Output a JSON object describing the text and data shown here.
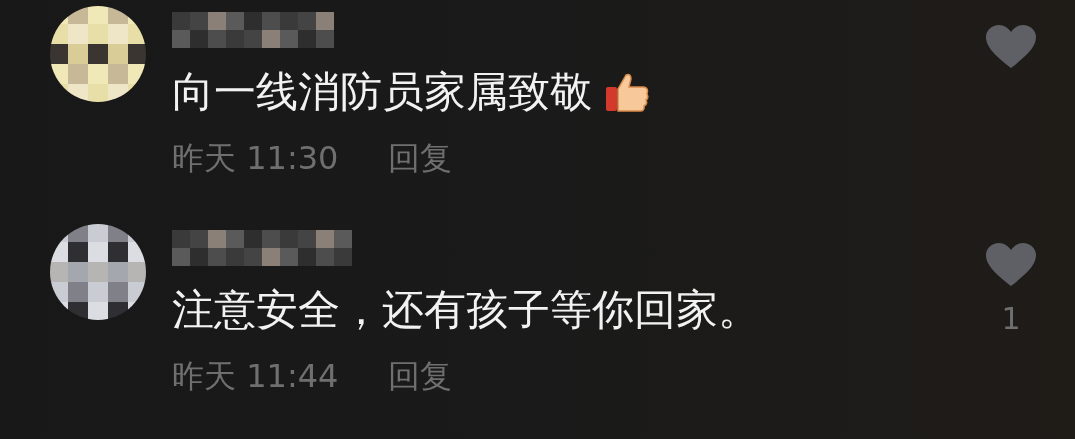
{
  "comments": [
    {
      "text": "向一线消防员家属致敬",
      "thumbs_up": true,
      "time": "昨天 11:30",
      "reply": "回复"
    },
    {
      "text": "注意安全，还有孩子等你回家。",
      "time": "昨天 11:44",
      "reply": "回复",
      "likes": "1",
      "thumbs_up": false
    }
  ]
}
